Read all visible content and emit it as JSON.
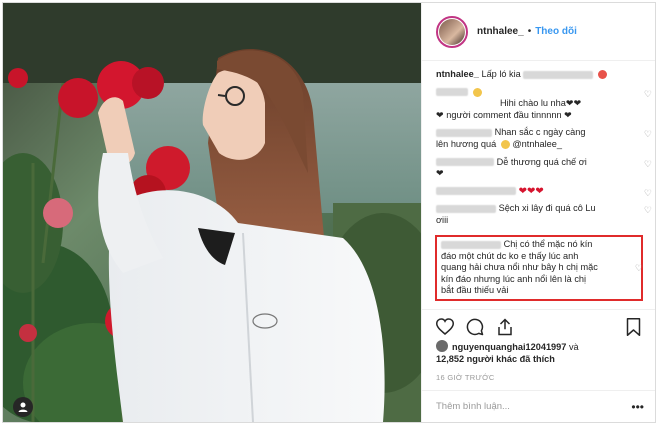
{
  "post": {
    "author": "ntnhalee_",
    "separator": "•",
    "follow_label": "Theo dõi",
    "caption_text": "Lấp ló kia",
    "photo_alt_icon": "user-avatar-icon"
  },
  "comments": [
    {
      "author_hidden": true,
      "text": "Hihi chào lu nha❤❤",
      "text2": "❤ người comment đầu tinnnnn ❤"
    },
    {
      "author_hidden": true,
      "text": "Nhan sắc c ngày càng",
      "text2": "lên hương quá",
      "mention": "@ntnhalee_"
    },
    {
      "author_hidden": true,
      "text": "Dễ thương quá chế ơi",
      "text2": "❤"
    },
    {
      "author_hidden": true,
      "text": "❤❤❤"
    },
    {
      "author_hidden": true,
      "text": "Sệch xi lây đi quá cô Lu",
      "text2": "ơiii"
    }
  ],
  "highlighted_comment": {
    "line1": "Chị có thể mặc nó kín",
    "line2": "đáo một chút dc ko e thấy lúc anh",
    "line3": "quang hải chưa nổi như bây h chị mặc",
    "line4": "kín đáo nhưng lúc anh nổi lên là chị",
    "line5": "bắt đầu thiếu vải"
  },
  "likes": {
    "liker": "nguyenquanghai12041997",
    "joiner": "và",
    "count": "12,852",
    "suffix": "người khác đã thích"
  },
  "timestamp": "16 GIỜ TRƯỚC",
  "comment_input": {
    "placeholder": "Thêm bình luận..."
  },
  "more_label": "•••",
  "colors": {
    "follow": "#3897f0",
    "highlight_border": "#e02b2b",
    "heart": "#d6142e"
  },
  "icons": [
    "heart-icon",
    "comment-icon",
    "share-icon",
    "bookmark-icon",
    "more-icon"
  ]
}
